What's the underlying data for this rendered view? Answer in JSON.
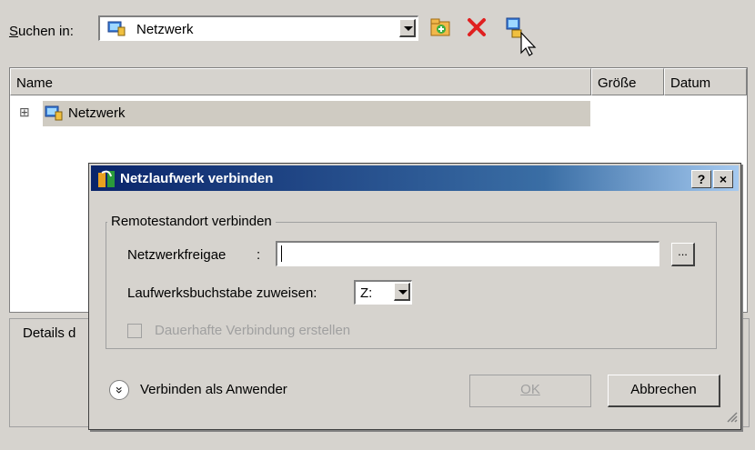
{
  "toolbar": {
    "search_label_underlined": "S",
    "search_label_rest": "uchen in:",
    "location_value": "Netzwerk"
  },
  "list": {
    "columns": [
      "Name",
      "Größe",
      "Datum"
    ],
    "tree_expander": "⊞",
    "tree_item": "Netzwerk"
  },
  "details": {
    "label": "Details d"
  },
  "dialog": {
    "title": "Netzlaufwerk verbinden",
    "help_btn": "?",
    "close_btn": "×",
    "group_label": "Remotestandort verbinden",
    "share_label": "Netzwerkfreigae",
    "share_colon": ":",
    "share_value": "",
    "browse_btn": "...",
    "drive_label": "Laufwerksbuchstabe zuweisen:",
    "drive_value": "Z:",
    "persistent_label": "Dauerhafte Verbindung erstellen",
    "persistent_checked": false,
    "expand_icon": "»",
    "connect_as": "Verbinden als Anwender",
    "ok_btn": "OK",
    "cancel_btn": "Abbrechen"
  }
}
